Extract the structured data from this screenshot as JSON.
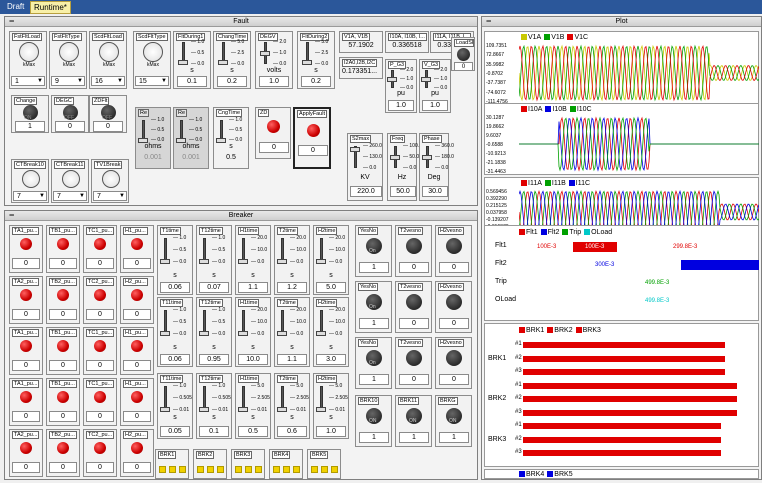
{
  "tabs": {
    "draft": "Draft",
    "runtime": "Runtime*"
  },
  "fault": {
    "title": "Fault",
    "dials": [
      {
        "label": "FstFltLoad",
        "value": "1"
      },
      {
        "label": "FstFltType",
        "value": "9"
      },
      {
        "label": "ScdFltLoad",
        "value": "16"
      },
      {
        "label": "ScdFltType",
        "value": "15"
      }
    ],
    "sliders": [
      {
        "label": "FltDuring1",
        "ticks": [
          "1.0",
          "0.5",
          "0.0"
        ],
        "unit": "s",
        "value": "0.1"
      },
      {
        "label": "ChangTime",
        "ticks": [
          "5.0",
          "2.5",
          "0.0"
        ],
        "unit": "s",
        "value": "0.2"
      },
      {
        "label": "DEGV",
        "ticks": [
          "2.0",
          "1.0",
          "0.0"
        ],
        "unit": "volts",
        "value": "1.0"
      },
      {
        "label": "FltDuring2",
        "ticks": [
          "5.0",
          "2.5",
          "0.0"
        ],
        "unit": "s",
        "value": "0.2"
      }
    ],
    "v1a_v1b": {
      "label": "V1A, V1B",
      "value": "57.1902"
    },
    "i10a": {
      "label": "I10A, I10B, I...",
      "value": "0.336518"
    },
    "i11a": {
      "label": "I11A, I11B, I...",
      "value": "0.336623"
    },
    "i2a0": {
      "label": "I2A0,I2B,I2C",
      "value": "0.173351..."
    },
    "pg3": {
      "label": "P_G3",
      "unit": "pu",
      "value": "1.0",
      "ticks": [
        "2.0",
        "1.0",
        "0.0"
      ]
    },
    "vg3": {
      "label": "V_G3",
      "unit": "pu",
      "value": "1.0",
      "ticks": [
        "2.0",
        "1.0",
        "0.0"
      ]
    },
    "loadsf": {
      "label": "LoadSF",
      "value": "0",
      "on": "ON",
      "off": "OFF"
    },
    "change": {
      "label": "Change",
      "value": "1",
      "on": "ON"
    },
    "degc": {
      "label": "DEGC",
      "value": "0",
      "off": "OFF"
    },
    "zdflt": {
      "label": "ZDFlt",
      "value": "0",
      "off": "OFF"
    },
    "re1": {
      "label": "Re",
      "ticks": [
        "1.0",
        "0.5",
        "0.0"
      ],
      "unit": "ohms",
      "value": "0.001"
    },
    "re2": {
      "label": "Re",
      "ticks": [
        "1.0",
        "0.5",
        "0.0"
      ],
      "unit": "ohms",
      "value": "0.001"
    },
    "cngtime": {
      "label": "CngTime",
      "ticks": [
        "1.0",
        "0.5",
        "0.0"
      ],
      "unit": "s",
      "value": "0.5"
    },
    "zd": {
      "label": "ZD",
      "value": "0"
    },
    "applyfault": {
      "label": "ApplyFault",
      "value": "0"
    },
    "s2max": {
      "label": "S2max",
      "ticks": [
        "260.0",
        "130.0",
        "0.0"
      ],
      "unit": "KV",
      "value": "220.0"
    },
    "freq": {
      "label": "Freq",
      "ticks": [
        "100.0",
        "50.0",
        "0.0"
      ],
      "unit": "Hz",
      "value": "50.0"
    },
    "phase": {
      "label": "Phase",
      "ticks": [
        "360.0",
        "180.0",
        "0.0"
      ],
      "unit": "Deg",
      "value": "30.0"
    },
    "ctbreak": [
      {
        "label": "CTBreak10",
        "value": "7"
      },
      {
        "label": "CTBreak11",
        "value": "7"
      },
      {
        "label": "TV1Break",
        "value": "7"
      }
    ]
  },
  "breaker": {
    "title": "Breaker",
    "leds": [
      [
        "TA1_pu...",
        "TB1_pu...",
        "TC1_pu...",
        "H1_pu..."
      ],
      [
        "TA2_pu...",
        "TB2_pu...",
        "TC2_pu...",
        "H2_pu..."
      ],
      [
        "TA1_pu...",
        "TB1_pu...",
        "TC1_pu...",
        "H1_pu..."
      ],
      [
        "TA1_pu...",
        "TB1_pu...",
        "TC1_pu...",
        "H1_pu..."
      ],
      [
        "TA2_pu...",
        "TB2_pu...",
        "TC2_pu...",
        "H2_pu..."
      ]
    ],
    "led_value": "0",
    "sliders": [
      [
        {
          "label": "T1time",
          "ticks": [
            "1.0",
            "0.5",
            "0.0"
          ],
          "value": "0.06"
        },
        {
          "label": "T12time",
          "ticks": [
            "1.0",
            "0.5",
            "0.0"
          ],
          "value": "0.07"
        },
        {
          "label": "H1time",
          "ticks": [
            "20.0",
            "10.0",
            "0.0"
          ],
          "value": "1.1"
        },
        {
          "label": "T2time",
          "ticks": [
            "20.0",
            "10.0",
            "0.0"
          ],
          "value": "1.2"
        },
        {
          "label": "H2time",
          "ticks": [
            "20.0",
            "10.0",
            "0.0"
          ],
          "value": "5.0"
        }
      ],
      [
        {
          "label": "T11time",
          "ticks": [
            "1.0",
            "0.5",
            "0.0"
          ],
          "value": "0.06"
        },
        {
          "label": "T12time",
          "ticks": [
            "1.0",
            "0.5",
            "0.0"
          ],
          "value": "0.95"
        },
        {
          "label": "H1time",
          "ticks": [
            "20.0",
            "10.0",
            "0.0"
          ],
          "value": "10.0"
        },
        {
          "label": "T2time",
          "ticks": [
            "20.0",
            "10.0",
            "0.0"
          ],
          "value": "1.1"
        },
        {
          "label": "H2time",
          "ticks": [
            "20.0",
            "10.0",
            "0.0"
          ],
          "value": "3.0"
        }
      ],
      [
        {
          "label": "T11time",
          "ticks": [
            "1.0",
            "0.505",
            "0.01"
          ],
          "value": "0.05"
        },
        {
          "label": "T12time",
          "ticks": [
            "1.0",
            "0.505",
            "0.01"
          ],
          "value": "0.1"
        },
        {
          "label": "H1time",
          "ticks": [
            "5.0",
            "2.505",
            "0.01"
          ],
          "value": "0.5"
        },
        {
          "label": "T2time",
          "ticks": [
            "5.0",
            "2.505",
            "0.01"
          ],
          "value": "0.6"
        },
        {
          "label": "H2time",
          "ticks": [
            "5.0",
            "2.505",
            "0.01"
          ],
          "value": "1.0"
        }
      ]
    ],
    "unit": "s",
    "knobs": [
      [
        {
          "label": "YesNo",
          "on": "On",
          "value": "1"
        },
        {
          "label": "T2vesno",
          "value": "0"
        },
        {
          "label": "H2vesno",
          "value": "0"
        }
      ],
      [
        {
          "label": "YesNo",
          "on": "On",
          "value": "1"
        },
        {
          "label": "T2vesno",
          "value": "0"
        },
        {
          "label": "H2vesno",
          "value": "0"
        }
      ],
      [
        {
          "label": "YesNo",
          "on": "On",
          "value": "1"
        },
        {
          "label": "T2vesno",
          "value": "0"
        },
        {
          "label": "H2vesno",
          "value": "0"
        }
      ],
      [
        {
          "label": "BRK10",
          "on": "ON",
          "value": "1"
        },
        {
          "label": "BRK11",
          "on": "ON",
          "value": "1"
        },
        {
          "label": "BRKG",
          "on": "ON",
          "value": "1"
        }
      ]
    ],
    "brk": [
      "BRK1",
      "BRK2",
      "BRK3",
      "BRK4",
      "BRK5"
    ]
  },
  "plot": {
    "title": "Plot",
    "p1": {
      "legend": [
        "V1A",
        "V1B",
        "V1C"
      ],
      "colors": [
        "#c8c800",
        "#00a000",
        "#e00000"
      ],
      "yticks": [
        "109.7351",
        "72.8667",
        "35.9982",
        "-0.8702",
        "-37.7387",
        "-74.6072",
        "-111.4756"
      ]
    },
    "p2": {
      "legend": [
        "I10A",
        "I10B",
        "I10C"
      ],
      "colors": [
        "#e00000",
        "#0000e0",
        "#00a000"
      ],
      "yticks": [
        "30.1287",
        "19.8662",
        "9.6037",
        "-0.6588",
        "-10.9213",
        "-21.1838",
        "-31.4463"
      ]
    },
    "p3": {
      "legend": [
        "I11A",
        "I11B",
        "I11C"
      ],
      "colors": [
        "#e00000",
        "#00a000",
        "#0000e0"
      ],
      "yticks": [
        "0.569456",
        "0.392290",
        "0.215125",
        "0.037958",
        "-0.139207",
        "-0.316373",
        "-0.493538"
      ]
    },
    "p4": {
      "legend": [
        "Flt1",
        "Flt2",
        "Trip",
        "OLoad"
      ],
      "colors": [
        "#e00000",
        "#0000e0",
        "#00a000",
        "#00c8c8"
      ],
      "rows": [
        "Flt1",
        "Flt2",
        "Trip",
        "OLoad"
      ],
      "annotations": [
        "100E-3",
        "100E-3",
        "299.8E-3",
        "300E-3",
        "100E-3",
        "499.8E-3",
        "499.8E-3"
      ]
    },
    "p5": {
      "legend": [
        "BRK1",
        "BRK2",
        "BRK3"
      ],
      "colors": [
        "#e00000",
        "#e00000",
        "#e00000"
      ],
      "rows": [
        {
          "group": "",
          "num": "#1"
        },
        {
          "group": "BRK1",
          "num": "#2"
        },
        {
          "group": "",
          "num": "#3"
        },
        {
          "group": "",
          "num": "#1"
        },
        {
          "group": "BRK2",
          "num": "#2"
        },
        {
          "group": "",
          "num": "#3"
        },
        {
          "group": "",
          "num": "#1"
        },
        {
          "group": "BRK3",
          "num": "#2"
        },
        {
          "group": "",
          "num": "#3"
        }
      ],
      "fractions": [
        0.88,
        0.88,
        0.88,
        0.93,
        0.93,
        0.93,
        0.86,
        0.86,
        0.86
      ]
    },
    "p6": {
      "legend": [
        "BRK4",
        "BRK5"
      ],
      "colors": [
        "#0000e0",
        "#0000e0"
      ]
    }
  }
}
